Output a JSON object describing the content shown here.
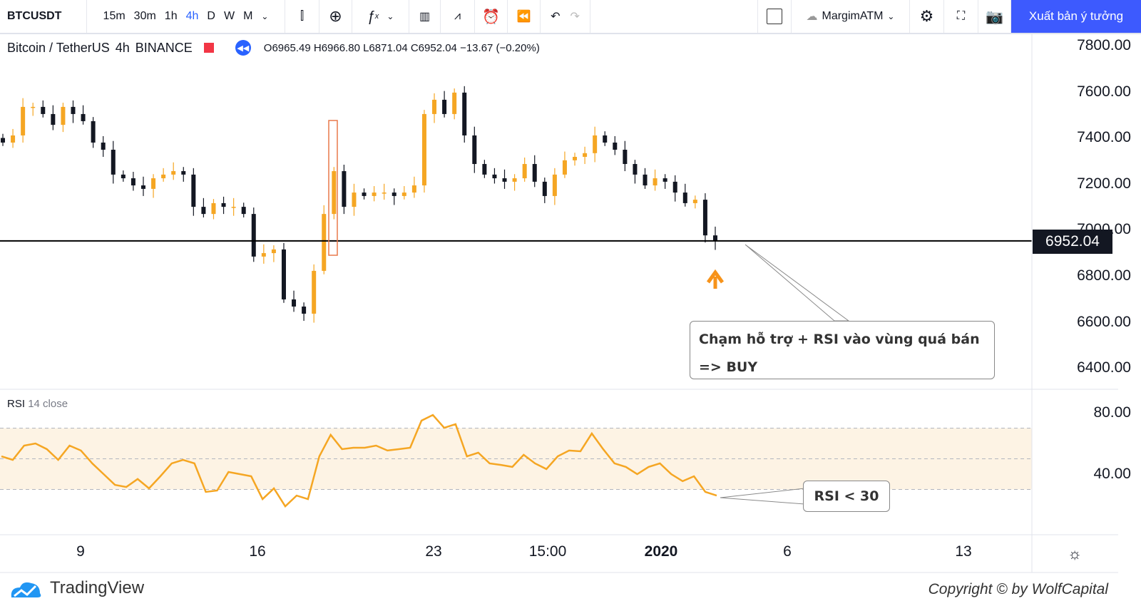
{
  "toolbar": {
    "symbol": "BTCUSDT",
    "timeframes": [
      "15m",
      "30m",
      "1h",
      "4h",
      "D",
      "W",
      "M"
    ],
    "active_timeframe": "4h",
    "layout_name": "MargimATM",
    "publish_label": "Xuất bản ý tưởng",
    "accent": "#3d5afe"
  },
  "legend": {
    "title": "Bitcoin / TetherUS",
    "interval": "4h",
    "exchange": "BINANCE",
    "open": "O6965.49",
    "high": "H6966.80",
    "low": "L6871.04",
    "close": "C6952.04",
    "change": "−13.67 (−0.20%)"
  },
  "rsi_label": {
    "name": "RSI",
    "params": "14 close"
  },
  "annotations": {
    "main_note_line1": "Chạm hỗ trợ + RSI vào vùng quá bán",
    "main_note_line2": "=> BUY",
    "rsi_note": "RSI < 30"
  },
  "footer": {
    "brand": "TradingView",
    "copyright": "Copyright © by WolfCapital"
  },
  "chart_data": [
    {
      "type": "candlestick",
      "series": [
        {
          "name": "BTCUSDT",
          "closes": [
            7379,
            7410,
            7534,
            7534,
            7503,
            7456,
            7534,
            7503,
            7472,
            7379,
            7348,
            7240,
            7224,
            7193,
            7178,
            7224,
            7240,
            7255,
            7240,
            7100,
            7069,
            7116,
            7100,
            7100,
            7069,
            6884,
            6899,
            6915,
            6698,
            6667,
            6636,
            6822,
            7069,
            7255,
            7100,
            7162,
            7147,
            7162,
            7162,
            7147,
            7162,
            7193,
            7503,
            7565,
            7503,
            7596,
            7410,
            7286,
            7240,
            7224,
            7209,
            7224,
            7286,
            7209,
            7147,
            7240,
            7302,
            7317,
            7333,
            7410,
            7379,
            7348,
            7286,
            7240,
            7193,
            7224,
            7209,
            7162,
            7116,
            7131,
            6976,
            6952
          ]
        }
      ],
      "y_ticks": [
        "7800.00",
        "7600.00",
        "7400.00",
        "7200.00",
        "7000.00",
        "6800.00",
        "6600.00",
        "6400.00"
      ],
      "ylim": [
        6380,
        7850
      ],
      "last_price": "6952.04",
      "support_level": 6952.04,
      "up_color": "#f5a623",
      "down_color": "#131722"
    },
    {
      "type": "line",
      "title": "RSI 14 close",
      "series": [
        {
          "name": "RSI",
          "values": [
            51.6,
            49.3,
            58.6,
            60,
            56.3,
            49.3,
            58.6,
            55.4,
            47,
            40,
            33,
            31.6,
            36.8,
            30.7,
            38.6,
            47,
            49.3,
            47,
            28.4,
            29.3,
            41.4,
            40,
            38.6,
            23.7,
            30.7,
            19,
            26,
            23.7,
            51.6,
            65.6,
            56.3,
            57.2,
            57.2,
            58.6,
            55.4,
            56.3,
            57.2,
            74.9,
            78.6,
            70.2,
            72.6,
            51.6,
            54,
            47,
            46,
            44.7,
            52.6,
            47,
            43.3,
            51.6,
            55.4,
            54.9,
            66.5,
            56.3,
            47,
            44.7,
            40,
            44.7,
            47,
            40,
            35.4,
            38.6,
            28.4,
            26
          ]
        }
      ],
      "y_ticks": [
        "80.00",
        "40.00"
      ],
      "bands": [
        30,
        50,
        70
      ],
      "color": "#f5a623"
    }
  ],
  "x_ticks": [
    "9",
    "16",
    "23",
    "15:00",
    "2020",
    "6",
    "13"
  ]
}
